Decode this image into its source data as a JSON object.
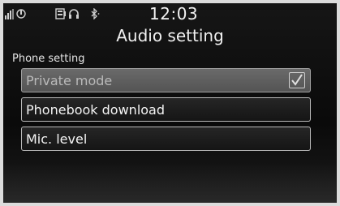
{
  "status_bar": {
    "time": "12:03",
    "icons": [
      "signal-strength-icon",
      "phone-battery-icon",
      "phone-book-icon",
      "headset-icon",
      "bluetooth-icon"
    ]
  },
  "title": "Audio setting",
  "section_label": "Phone setting",
  "menu": {
    "items": [
      {
        "label": "Private mode",
        "checked": true,
        "disabled": true
      },
      {
        "label": "Phonebook download"
      },
      {
        "label": "Mic. level"
      }
    ]
  }
}
